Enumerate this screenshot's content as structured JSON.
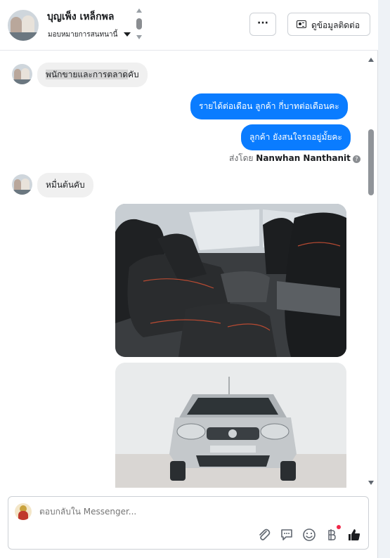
{
  "header": {
    "contact_name": "บุญเพ็ง เหล็กพล",
    "assign_label": "มอบหมายการสนทนานี้",
    "more_label": "···",
    "contact_info_label": "ดูข้อมูลติดต่อ"
  },
  "messages": [
    {
      "direction": "incoming",
      "text_highlighted": "พนักขายและการตลาด",
      "text_rest": "คับ"
    },
    {
      "direction": "outgoing",
      "text": "รายได้ต่อเดือน  ลูกค้า กี่บาทต่อเดือนคะ"
    },
    {
      "direction": "outgoing",
      "text": "ลูกค้า ยังสนใจรถอยู่มั้ยคะ"
    },
    {
      "direction": "incoming",
      "text": "หมื่นต้นคับ"
    }
  ],
  "sent_by": {
    "prefix": "ส่งโดย",
    "name": "Nanwhan Nanthanit"
  },
  "composer": {
    "placeholder": "ตอบกลับใน Messenger..."
  },
  "colors": {
    "outgoing_bubble": "#0a7cff",
    "incoming_bubble": "#f0f0f0",
    "notification_dot": "#f02849"
  },
  "icons": [
    "attachment-icon",
    "saved-replies-icon",
    "emoji-icon",
    "payment-icon",
    "like-icon"
  ]
}
